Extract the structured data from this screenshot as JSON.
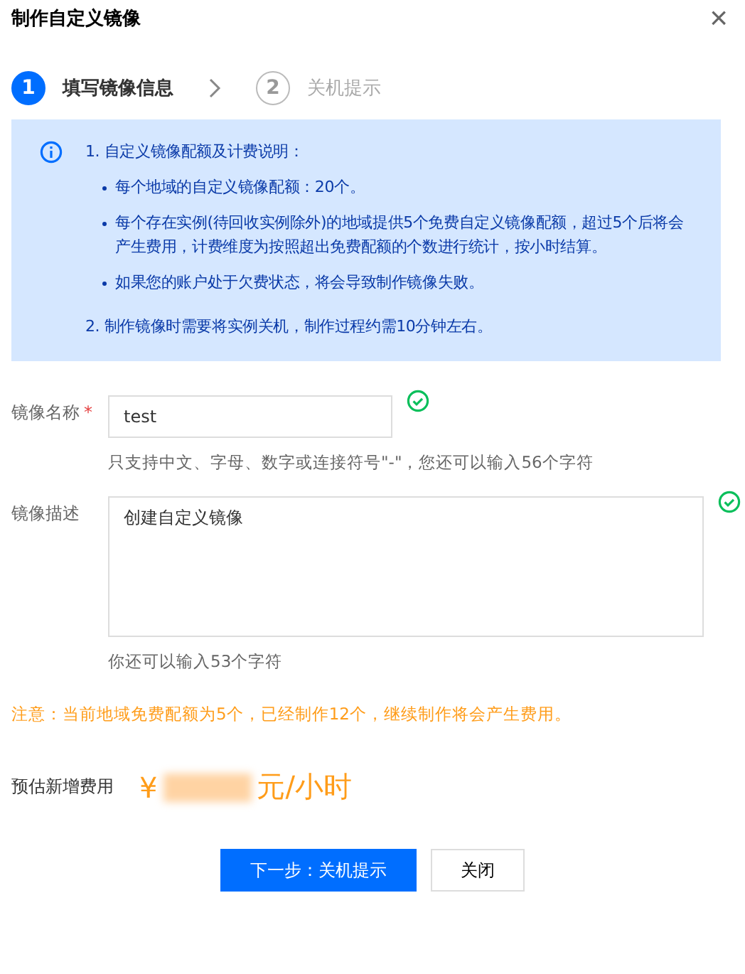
{
  "dialog": {
    "title": "制作自定义镜像",
    "close": "×"
  },
  "steps": [
    {
      "number": "1",
      "label": "填写镜像信息",
      "selected": true
    },
    {
      "number": "2",
      "label": "关机提示",
      "selected": false
    }
  ],
  "notice": {
    "items": [
      {
        "text": "1. 自定义镜像配额及计费说明：",
        "bullets": [
          "每个地域的自定义镜像配额：20个。",
          "每个存在实例(待回收实例除外)的地域提供5个免费自定义镜像配额，超过5个后将会产生费用，计费维度为按照超出免费配额的个数进行统计，按小时结算。",
          "如果您的账户处于欠费状态，将会导致制作镜像失败。"
        ]
      },
      {
        "text": "2. 制作镜像时需要将实例关机，制作过程约需10分钟左右。"
      }
    ]
  },
  "form": [
    {
      "kind": "input",
      "label": "镜像名称",
      "required_mark": "*",
      "value": "test",
      "valid": true,
      "hint": "只支持中文、字母、数字或连接符号\"-\"，您还可以输入56个字符"
    },
    {
      "kind": "textarea",
      "label": "镜像描述",
      "value": "创建自定义镜像",
      "valid": true,
      "hint": "你还可以输入53个字符"
    }
  ],
  "warning": "注意：当前地域免费配额为5个，已经制作12个，继续制作将会产生费用。",
  "cost": {
    "label": "预估新增费用",
    "currency": "¥",
    "unit": "元/小时"
  },
  "buttons": [
    {
      "label": "下一步：关机提示",
      "primary": true
    },
    {
      "label": "关闭",
      "primary": false
    }
  ]
}
